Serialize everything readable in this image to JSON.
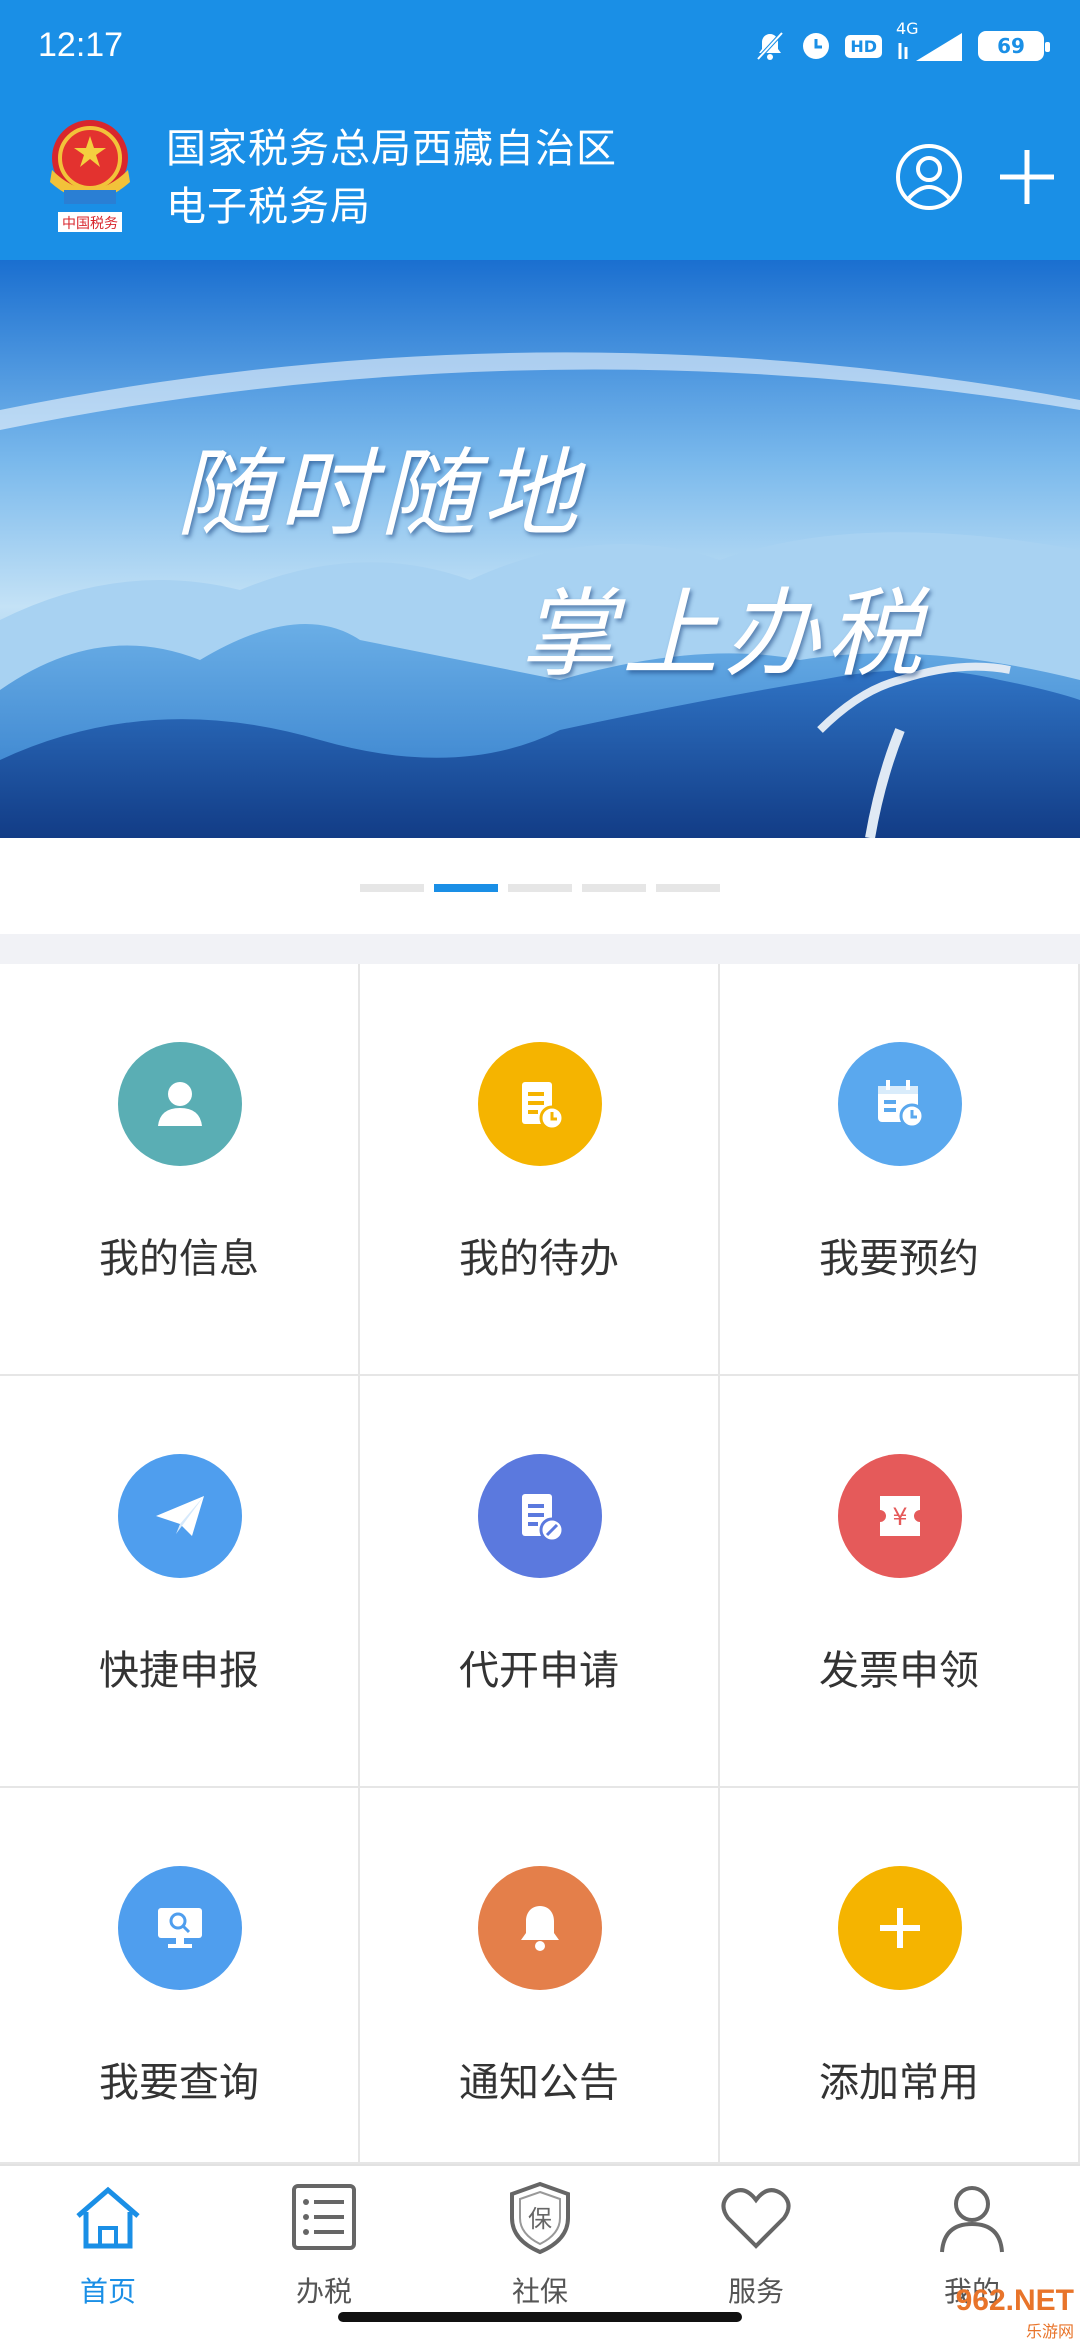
{
  "status_bar": {
    "time": "12:17",
    "hd": "HD",
    "network": "4G",
    "battery": "69"
  },
  "header": {
    "title_line1": "国家税务总局西藏自治区",
    "title_line2": "电子税务局",
    "background": "#1a8fe6"
  },
  "banner": {
    "text1": "随时随地",
    "text2": "掌上办税",
    "slide_count": 5,
    "active_slide": 2
  },
  "grid": {
    "items": [
      {
        "label": "我的信息",
        "icon": "user-icon",
        "color": "#5aaeb4"
      },
      {
        "label": "我的待办",
        "icon": "todo-document-icon",
        "color": "#f5b400"
      },
      {
        "label": "我要预约",
        "icon": "calendar-icon",
        "color": "#5aa8ee"
      },
      {
        "label": "快捷申报",
        "icon": "paper-plane-icon",
        "color": "#4f9eee"
      },
      {
        "label": "代开申请",
        "icon": "edit-document-icon",
        "color": "#5b79de"
      },
      {
        "label": "发票申领",
        "icon": "yuan-ticket-icon",
        "color": "#e55a5a"
      },
      {
        "label": "我要查询",
        "icon": "monitor-search-icon",
        "color": "#4f9eee"
      },
      {
        "label": "通知公告",
        "icon": "bell-icon",
        "color": "#e47f4a"
      },
      {
        "label": "添加常用",
        "icon": "plus-icon",
        "color": "#f5b400"
      }
    ]
  },
  "bottom_nav": {
    "items": [
      {
        "label": "首页",
        "icon": "home-icon",
        "active": true
      },
      {
        "label": "办税",
        "icon": "list-icon",
        "active": false
      },
      {
        "label": "社保",
        "icon": "shield-icon",
        "active": false
      },
      {
        "label": "服务",
        "icon": "heart-icon",
        "active": false
      },
      {
        "label": "我的",
        "icon": "person-icon",
        "active": false
      }
    ],
    "shield_text": "保"
  },
  "watermark": {
    "text": "962.NET",
    "subtext": "乐游网"
  }
}
